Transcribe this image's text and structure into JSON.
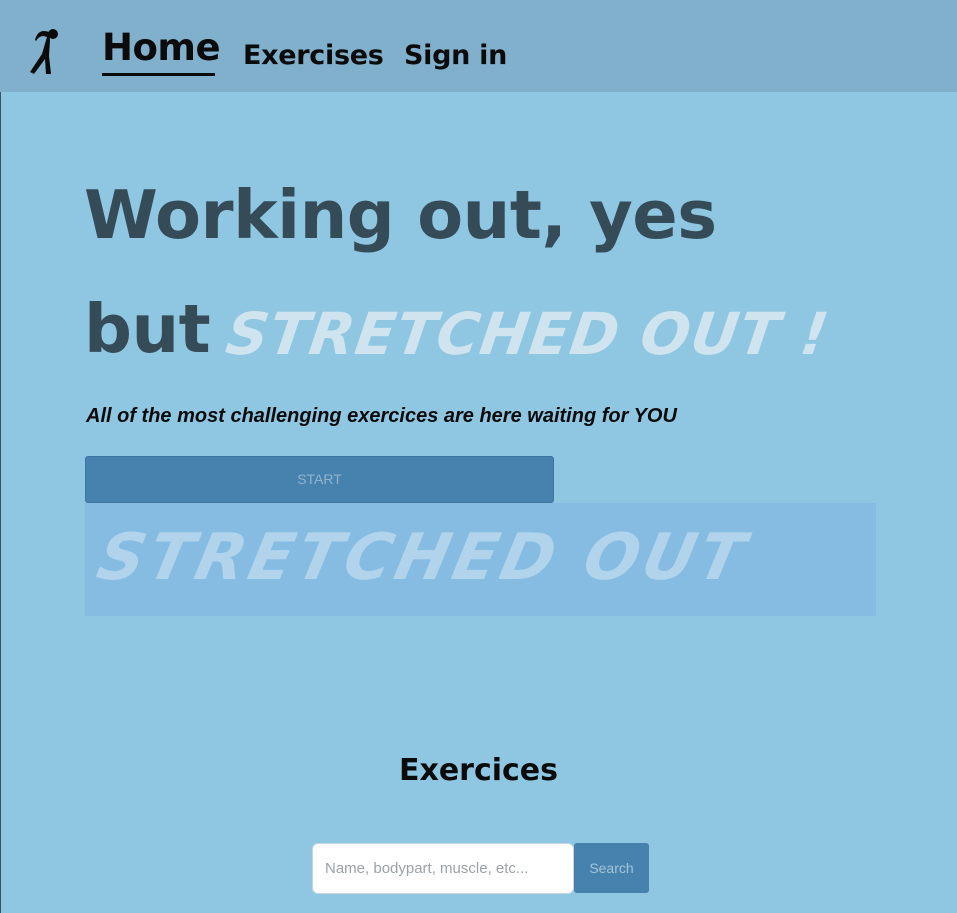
{
  "nav": {
    "logo_icon": "stretching-figure-icon",
    "links": [
      {
        "label": "Home",
        "active": true
      },
      {
        "label": "Exercises",
        "active": false
      },
      {
        "label": "Sign in",
        "active": false
      }
    ]
  },
  "hero": {
    "line1": "Working out, yes",
    "line2_prefix": "but",
    "line2_accent": "STRETCHED OUT !",
    "subtitle": "All of the most challenging exercices are here waiting for YOU",
    "start_label": "START",
    "banner_text": "STRETCHED OUT"
  },
  "exercises": {
    "title": "Exercices",
    "search_placeholder": "Name, bodypart, muscle, etc...",
    "search_label": "Search"
  },
  "colors": {
    "background": "#8fc7e3",
    "navbar": "#80b0cb",
    "button": "#4682ad",
    "heading": "#354b58",
    "accent_text": "#cfe4ee"
  }
}
